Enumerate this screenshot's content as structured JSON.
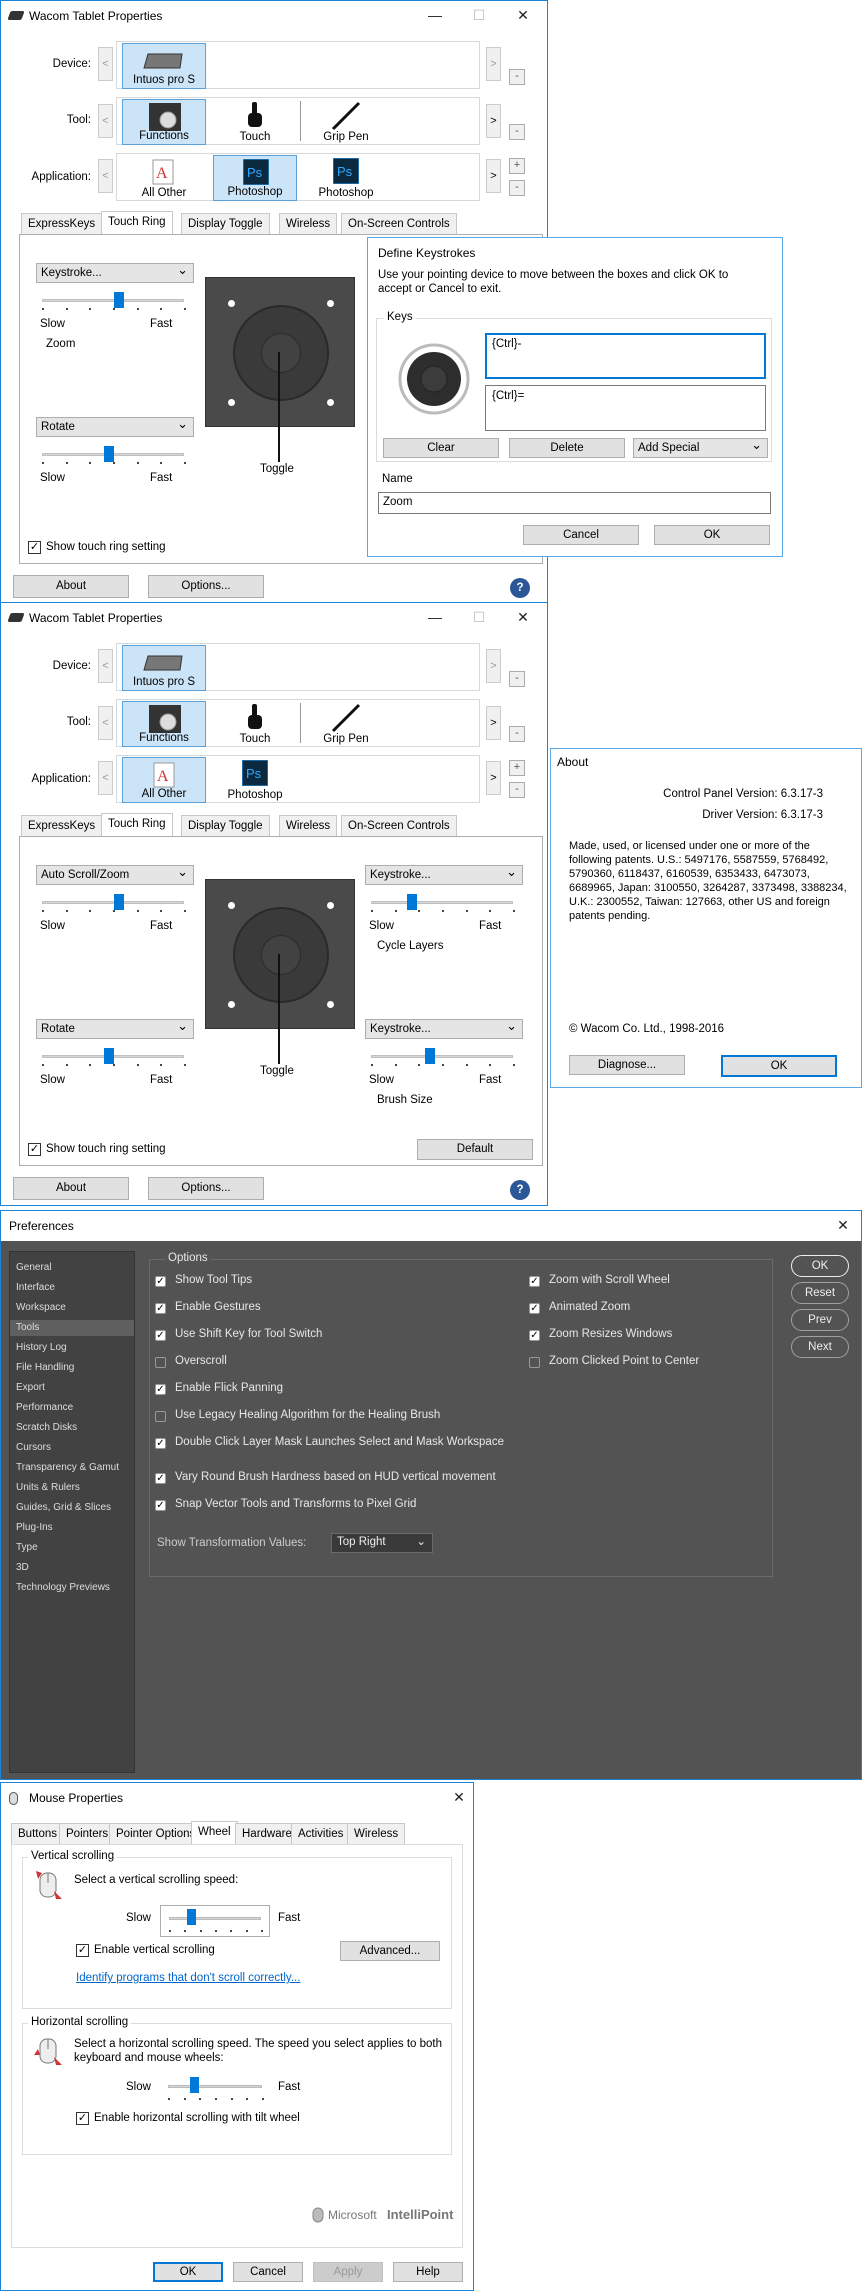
{
  "w1": {
    "title": "Wacom Tablet Properties",
    "device_label": "Device:",
    "tool_label": "Tool:",
    "application_label": "Application:",
    "devices": [
      "Intuos pro S"
    ],
    "tools": [
      "Functions",
      "Touch",
      "Grip Pen"
    ],
    "applications": [
      "All Other",
      "Photoshop",
      "Photoshop"
    ],
    "tabs": [
      "ExpressKeys",
      "Touch Ring",
      "Display Toggle",
      "Wireless",
      "On-Screen Controls"
    ],
    "left_top_dropdown": "Keystroke...",
    "left_top_caption": "Zoom",
    "left_bottom_dropdown": "Rotate",
    "slow": "Slow",
    "fast": "Fast",
    "toggle_label": "Toggle",
    "show_touch_ring": "Show touch ring setting",
    "about": "About",
    "options": "Options...",
    "help": "?"
  },
  "define_keystrokes": {
    "title": "Define Keystrokes",
    "instructions": "Use your pointing device to move between the boxes and click OK to accept or Cancel to exit.",
    "keys_group": "Keys",
    "key1": "{Ctrl}-",
    "key2": "{Ctrl}=",
    "clear": "Clear",
    "delete": "Delete",
    "add_special": "Add Special",
    "name_label": "Name",
    "name_value": "Zoom",
    "cancel": "Cancel",
    "ok": "OK"
  },
  "w2": {
    "title": "Wacom Tablet Properties",
    "device_label": "Device:",
    "tool_label": "Tool:",
    "application_label": "Application:",
    "devices": [
      "Intuos pro S"
    ],
    "tools": [
      "Functions",
      "Touch",
      "Grip Pen"
    ],
    "applications": [
      "All Other",
      "Photoshop"
    ],
    "tabs": [
      "ExpressKeys",
      "Touch Ring",
      "Display Toggle",
      "Wireless",
      "On-Screen Controls"
    ],
    "left_top_dropdown": "Auto Scroll/Zoom",
    "left_bottom_dropdown": "Rotate",
    "right_top_dropdown": "Keystroke...",
    "right_top_caption": "Cycle Layers",
    "right_bottom_dropdown": "Keystroke...",
    "right_bottom_caption": "Brush Size",
    "slow": "Slow",
    "fast": "Fast",
    "toggle_label": "Toggle",
    "show_touch_ring": "Show touch ring setting",
    "default": "Default",
    "about": "About",
    "options": "Options...",
    "help": "?"
  },
  "about": {
    "title": "About",
    "cp_version": "Control Panel Version: 6.3.17-3",
    "drv_version": "Driver Version: 6.3.17-3",
    "patents": "Made, used, or licensed under one or more of the following patents. U.S.: 5497176, 5587559, 5768492, 5790360, 6118437, 6160539, 6353433, 6473073, 6689965, Japan: 3100550, 3264287, 3373498, 3388234, U.K.: 2300552, Taiwan: 127663, other US and foreign patents pending.",
    "copyright": "© Wacom Co. Ltd., 1998-2016",
    "diagnose": "Diagnose...",
    "ok": "OK"
  },
  "prefs": {
    "title": "Preferences",
    "sidebar": [
      "General",
      "Interface",
      "Workspace",
      "Tools",
      "History Log",
      "File Handling",
      "Export",
      "Performance",
      "Scratch Disks",
      "Cursors",
      "Transparency & Gamut",
      "Units & Rulers",
      "Guides, Grid & Slices",
      "Plug-Ins",
      "Type",
      "3D",
      "Technology Previews"
    ],
    "options_title": "Options",
    "left_options": [
      {
        "label": "Show Tool Tips",
        "checked": true
      },
      {
        "label": "Enable Gestures",
        "checked": true
      },
      {
        "label": "Use Shift Key for Tool Switch",
        "checked": true
      },
      {
        "label": "Overscroll",
        "checked": false
      },
      {
        "label": "Enable Flick Panning",
        "checked": true
      },
      {
        "label": "Use Legacy Healing Algorithm for the Healing Brush",
        "checked": false
      },
      {
        "label": "Double Click Layer Mask Launches Select and Mask Workspace",
        "checked": true
      },
      {
        "label": "Vary Round Brush Hardness based on HUD vertical movement",
        "checked": true
      },
      {
        "label": "Snap Vector Tools and Transforms to Pixel Grid",
        "checked": true
      }
    ],
    "right_options": [
      {
        "label": "Zoom with Scroll Wheel",
        "checked": true
      },
      {
        "label": "Animated Zoom",
        "checked": true
      },
      {
        "label": "Zoom Resizes Windows",
        "checked": true
      },
      {
        "label": "Zoom Clicked Point to Center",
        "checked": false
      }
    ],
    "transform_label": "Show Transformation Values:",
    "transform_value": "Top Right",
    "ok": "OK",
    "reset": "Reset",
    "prev": "Prev",
    "next": "Next"
  },
  "mouse": {
    "title": "Mouse Properties",
    "tabs": [
      "Buttons",
      "Pointers",
      "Pointer Options",
      "Wheel",
      "Hardware",
      "Activities",
      "Wireless"
    ],
    "vertical_group": "Vertical scrolling",
    "vertical_text": "Select a vertical scrolling speed:",
    "slow": "Slow",
    "fast": "Fast",
    "enable_vertical": "Enable vertical scrolling",
    "advanced": "Advanced...",
    "identify_link": "Identify programs that don't scroll correctly...",
    "horizontal_group": "Horizontal scrolling",
    "horizontal_text": "Select a horizontal scrolling speed. The speed you select applies to both keyboard and mouse wheels:",
    "enable_horizontal": "Enable horizontal scrolling with tilt wheel",
    "brand": "Microsoft",
    "brand_product": "IntelliPoint",
    "ok": "OK",
    "cancel": "Cancel",
    "apply": "Apply",
    "help": "Help"
  }
}
